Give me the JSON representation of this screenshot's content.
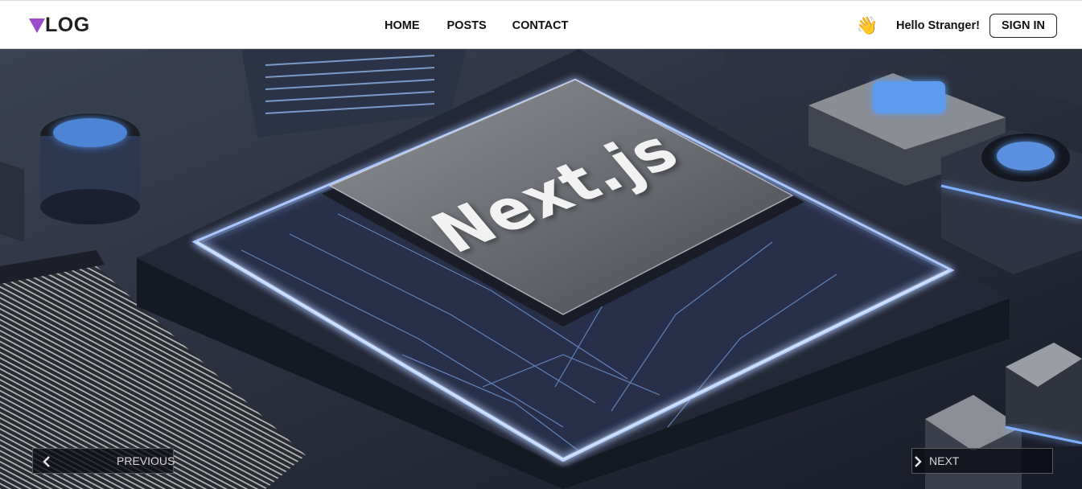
{
  "brand": {
    "logo_text": "LOG",
    "logo_mark_color": "#9b4dca"
  },
  "nav": {
    "items": [
      {
        "label": "HOME"
      },
      {
        "label": "POSTS"
      },
      {
        "label": "CONTACT"
      }
    ]
  },
  "user": {
    "wave_icon": "waving-hand-icon",
    "greeting": "Hello Stranger!",
    "signin_label": "SIGN IN"
  },
  "hero": {
    "slide_text": "Next.js",
    "prev_label": "PREVIOUS",
    "next_label": "NEXT",
    "accent_color": "#6fa8ff"
  }
}
